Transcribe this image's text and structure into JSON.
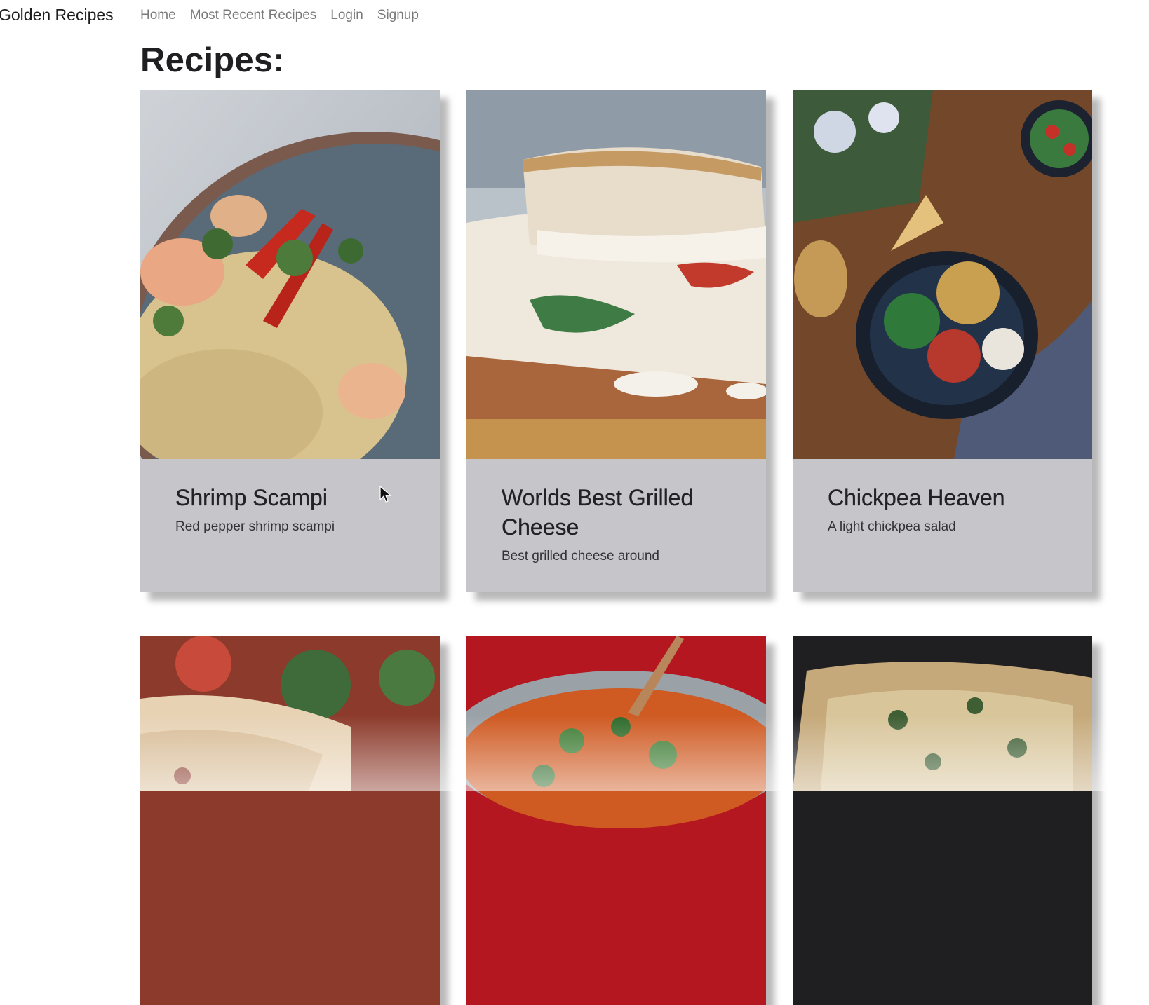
{
  "nav": {
    "brand": "Golden Recipes",
    "links": [
      {
        "label": "Home"
      },
      {
        "label": "Most Recent Recipes"
      },
      {
        "label": "Login"
      },
      {
        "label": "Signup"
      }
    ]
  },
  "page": {
    "title": "Recipes:"
  },
  "recipes": [
    {
      "title": "Shrimp Scampi",
      "description": "Red pepper shrimp scampi",
      "image": "shrimp-scampi-photo"
    },
    {
      "title": "Worlds Best Grilled Cheese",
      "description": "Best grilled cheese around",
      "image": "grilled-cheese-photo"
    },
    {
      "title": "Chickpea Heaven",
      "description": "A light chickpea salad",
      "image": "chickpea-salad-photo"
    },
    {
      "image": "wrap-photo"
    },
    {
      "image": "curry-photo"
    },
    {
      "image": "casserole-photo"
    }
  ],
  "colors": {
    "card_background": "#c6c5ca",
    "nav_link": "#7a7a7a"
  }
}
